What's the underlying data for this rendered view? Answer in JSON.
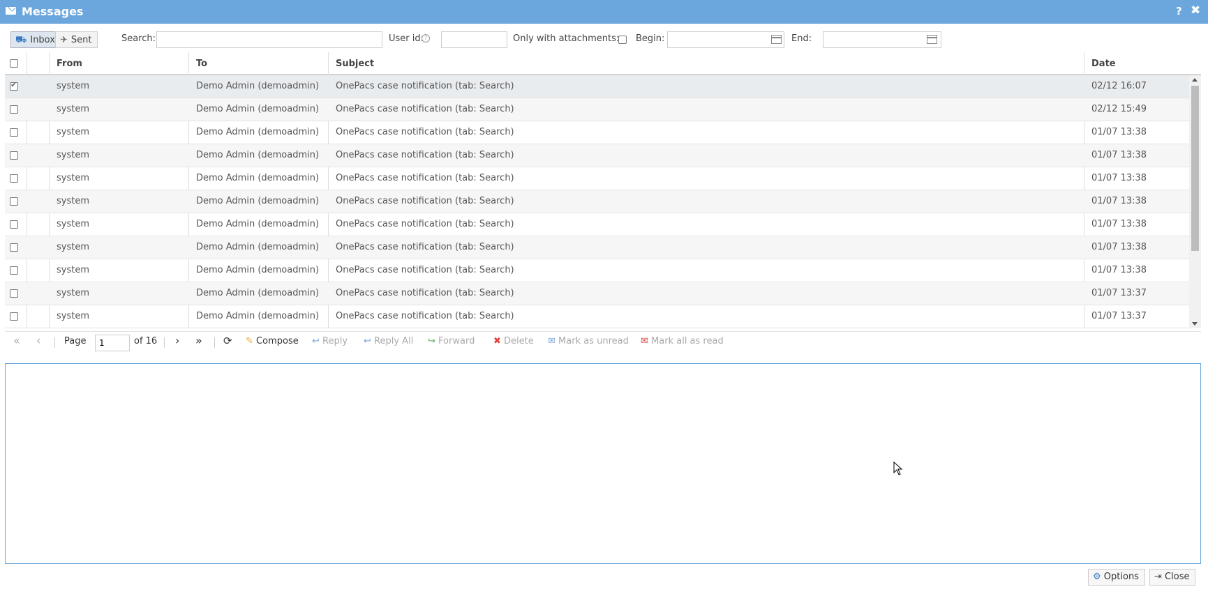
{
  "window": {
    "title": "Messages",
    "help": "?",
    "close": "✖"
  },
  "toolbar": {
    "tabs": [
      {
        "label": "Inbox",
        "icon": "inbox-icon",
        "glyph": "⛟"
      },
      {
        "label": "Sent",
        "icon": "paper-plane-icon",
        "glyph": "✈"
      }
    ],
    "search_label": "Search:",
    "search_value": "",
    "userid_label": "User id:",
    "userid_value": "",
    "attachments_label": "Only with attachments:",
    "begin_label": "Begin:",
    "begin_value": "",
    "end_label": "End:",
    "end_value": ""
  },
  "grid": {
    "columns": [
      "From",
      "To",
      "Subject",
      "Date"
    ],
    "rows": [
      {
        "from": "system",
        "to": "Demo Admin (demoadmin)",
        "subject": "OnePacs case notification (tab: Search)",
        "date": "02/12 16:07",
        "checked": true
      },
      {
        "from": "system",
        "to": "Demo Admin (demoadmin)",
        "subject": "OnePacs case notification (tab: Search)",
        "date": "02/12 15:49",
        "checked": false
      },
      {
        "from": "system",
        "to": "Demo Admin (demoadmin)",
        "subject": "OnePacs case notification (tab: Search)",
        "date": "01/07 13:38",
        "checked": false
      },
      {
        "from": "system",
        "to": "Demo Admin (demoadmin)",
        "subject": "OnePacs case notification (tab: Search)",
        "date": "01/07 13:38",
        "checked": false
      },
      {
        "from": "system",
        "to": "Demo Admin (demoadmin)",
        "subject": "OnePacs case notification (tab: Search)",
        "date": "01/07 13:38",
        "checked": false
      },
      {
        "from": "system",
        "to": "Demo Admin (demoadmin)",
        "subject": "OnePacs case notification (tab: Search)",
        "date": "01/07 13:38",
        "checked": false
      },
      {
        "from": "system",
        "to": "Demo Admin (demoadmin)",
        "subject": "OnePacs case notification (tab: Search)",
        "date": "01/07 13:38",
        "checked": false
      },
      {
        "from": "system",
        "to": "Demo Admin (demoadmin)",
        "subject": "OnePacs case notification (tab: Search)",
        "date": "01/07 13:38",
        "checked": false
      },
      {
        "from": "system",
        "to": "Demo Admin (demoadmin)",
        "subject": "OnePacs case notification (tab: Search)",
        "date": "01/07 13:38",
        "checked": false
      },
      {
        "from": "system",
        "to": "Demo Admin (demoadmin)",
        "subject": "OnePacs case notification (tab: Search)",
        "date": "01/07 13:37",
        "checked": false
      },
      {
        "from": "system",
        "to": "Demo Admin (demoadmin)",
        "subject": "OnePacs case notification (tab: Search)",
        "date": "01/07 13:37",
        "checked": false
      }
    ]
  },
  "pager": {
    "page_label": "Page",
    "page_value": "1",
    "of_label": "of 16",
    "compose": "Compose",
    "reply": "Reply",
    "reply_all": "Reply All",
    "forward": "Forward",
    "delete": "Delete",
    "mark_unread": "Mark as unread",
    "mark_all_read": "Mark all as read"
  },
  "footer": {
    "options": "Options",
    "close": "Close"
  },
  "colors": {
    "titlebar": "#6ba7dd",
    "compose_icon": "#f0a830",
    "forward_icon": "#5bb56a",
    "delete_icon": "#e04040",
    "mark_all_icon": "#e04040"
  }
}
